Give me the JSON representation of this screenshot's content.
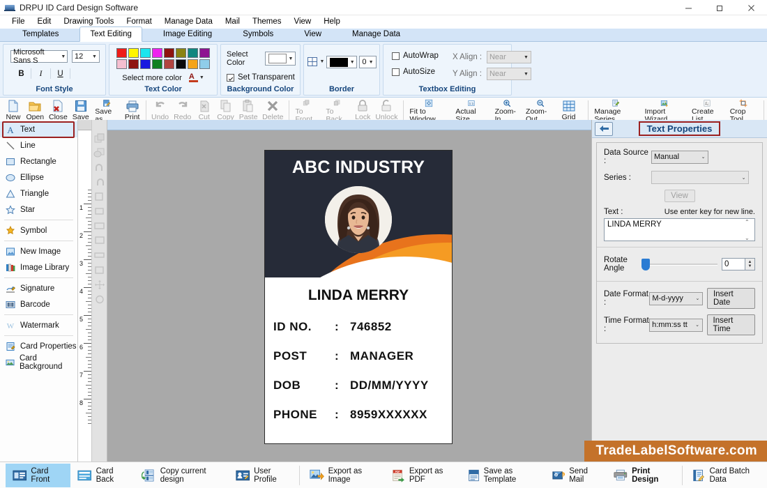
{
  "window": {
    "title": "DRPU ID Card Design Software",
    "minimize": "–",
    "maximize": "❐",
    "close": "✕"
  },
  "menubar": {
    "items": [
      "File",
      "Edit",
      "Drawing Tools",
      "Format",
      "Manage Data",
      "Mail",
      "Themes",
      "View",
      "Help"
    ]
  },
  "ribbon_tabs": {
    "items": [
      "Templates",
      "Text Editing",
      "Image Editing",
      "Symbols",
      "View",
      "Manage Data"
    ],
    "active": "Text Editing"
  },
  "ribbon": {
    "font_style": {
      "group_label": "Font Style",
      "font_name": "Microsoft Sans S",
      "font_size": "12",
      "bold": "B",
      "italic": "I",
      "underline": "U"
    },
    "text_color": {
      "group_label": "Text Color",
      "select_more_color": "Select more color",
      "font_color_glyph": "A",
      "swatches_row1": [
        "#ee1c18",
        "#fff600",
        "#1ce6ee",
        "#ee22ee",
        "#8e1410",
        "#8a8313",
        "#11877f",
        "#8e1491"
      ],
      "swatches_row2": [
        "#f5bfd0",
        "#8e1410",
        "#1919e0",
        "#0d8020",
        "#b14440",
        "#0a0a0a",
        "#f5a31a",
        "#8fcdea"
      ]
    },
    "background_color": {
      "group_label": "Background Color",
      "select_color_label": "Select Color",
      "selected_color": "#ffffff",
      "set_transparent": "Set Transparent",
      "set_transparent_checked": true
    },
    "border": {
      "group_label": "Border",
      "border_color": "#000000",
      "border_width": "0"
    },
    "textbox_editing": {
      "group_label": "Textbox Editing",
      "autowrap": "AutoWrap",
      "autowrap_checked": false,
      "autosize": "AutoSize",
      "autosize_checked": false,
      "x_align_label": "X Align :",
      "x_align_value": "Near",
      "y_align_label": "Y Align :",
      "y_align_value": "Near"
    }
  },
  "toolbar": {
    "groups": [
      [
        {
          "label": "New",
          "icon": "new-document-icon",
          "enabled": true
        },
        {
          "label": "Open",
          "icon": "open-folder-icon",
          "enabled": true
        },
        {
          "label": "Close",
          "icon": "close-document-icon",
          "enabled": true
        },
        {
          "label": "Save",
          "icon": "save-disk-icon",
          "enabled": true
        },
        {
          "label": "Save as",
          "icon": "save-as-icon",
          "enabled": true
        },
        {
          "label": "Print",
          "icon": "printer-icon",
          "enabled": true
        }
      ],
      [
        {
          "label": "Undo",
          "icon": "undo-arrow-icon",
          "enabled": false
        },
        {
          "label": "Redo",
          "icon": "redo-arrow-icon",
          "enabled": false
        },
        {
          "label": "Cut",
          "icon": "cut-icon",
          "enabled": false
        },
        {
          "label": "Copy",
          "icon": "copy-icon",
          "enabled": false
        },
        {
          "label": "Paste",
          "icon": "paste-icon",
          "enabled": false
        },
        {
          "label": "Delete",
          "icon": "delete-cross-icon",
          "enabled": false
        }
      ],
      [
        {
          "label": "To Front",
          "icon": "to-front-icon",
          "enabled": false
        },
        {
          "label": "To Back",
          "icon": "to-back-icon",
          "enabled": false
        },
        {
          "label": "Lock",
          "icon": "lock-icon",
          "enabled": false
        },
        {
          "label": "Unlock",
          "icon": "unlock-icon",
          "enabled": false
        }
      ],
      [
        {
          "label": "Fit to Window",
          "icon": "fit-to-window-icon",
          "enabled": true
        },
        {
          "label": "Actual Size",
          "icon": "actual-size-icon",
          "enabled": true
        },
        {
          "label": "Zoom-In",
          "icon": "zoom-in-icon",
          "enabled": true
        },
        {
          "label": "Zoom-Out",
          "icon": "zoom-out-icon",
          "enabled": true
        },
        {
          "label": "Grid",
          "icon": "grid-icon",
          "enabled": true
        }
      ],
      [
        {
          "label": "Manage Series",
          "icon": "manage-series-icon",
          "enabled": true
        },
        {
          "label": "Import Wizard",
          "icon": "import-wizard-icon",
          "enabled": true
        },
        {
          "label": "Create List",
          "icon": "create-list-icon",
          "enabled": true
        },
        {
          "label": "Crop Tool",
          "icon": "crop-tool-icon",
          "enabled": true
        }
      ]
    ]
  },
  "left_tools": {
    "selected": "Text",
    "groups": [
      [
        {
          "label": "Text",
          "icon": "text-a-icon"
        },
        {
          "label": "Line",
          "icon": "line-icon"
        },
        {
          "label": "Rectangle",
          "icon": "rectangle-icon"
        },
        {
          "label": "Ellipse",
          "icon": "ellipse-icon"
        },
        {
          "label": "Triangle",
          "icon": "triangle-icon"
        },
        {
          "label": "Star",
          "icon": "star-icon"
        }
      ],
      [
        {
          "label": "Symbol",
          "icon": "symbol-icon"
        }
      ],
      [
        {
          "label": "New Image",
          "icon": "new-image-icon"
        },
        {
          "label": "Image Library",
          "icon": "image-library-icon"
        }
      ],
      [
        {
          "label": "Signature",
          "icon": "signature-icon"
        },
        {
          "label": "Barcode",
          "icon": "barcode-icon"
        }
      ],
      [
        {
          "label": "Watermark",
          "icon": "watermark-icon"
        }
      ],
      [
        {
          "label": "Card Properties",
          "icon": "card-properties-icon"
        },
        {
          "label": "Card Background",
          "icon": "card-background-icon"
        }
      ]
    ]
  },
  "ruler": {
    "marks": [
      "1",
      "2",
      "3",
      "4",
      "5",
      "6",
      "7",
      "8"
    ]
  },
  "card": {
    "company_title": "ABC INDUSTRY",
    "holder_name": "LINDA MERRY",
    "header_bg": "#262b38",
    "accent_color": "#e8731c",
    "accent_color2": "#f59b23",
    "fields": [
      {
        "label": "ID NO.",
        "sep": ":",
        "value": "746852"
      },
      {
        "label": "POST",
        "sep": ":",
        "value": "MANAGER"
      },
      {
        "label": "DOB",
        "sep": ":",
        "value": "DD/MM/YYYY"
      },
      {
        "label": "PHONE",
        "sep": ":",
        "value": "8959XXXXXX"
      }
    ]
  },
  "right_panel": {
    "title": "Text Properties",
    "back_icon": "back-arrow-icon",
    "data_source_label": "Data Source :",
    "data_source_value": "Manual",
    "series_label": "Series :",
    "series_value": "",
    "view_button": "View",
    "text_label": "Text :",
    "text_hint": "Use enter key for new line.",
    "text_value": "LINDA MERRY",
    "rotate_label_line1": "Rotate",
    "rotate_label_line2": "Angle",
    "rotate_value": "0",
    "date_format_label": "Date Format :",
    "date_format_value": "M-d-yyyy",
    "insert_date_button": "Insert Date",
    "time_format_label": "Time Format :",
    "time_format_value": "h:mm:ss tt",
    "insert_time_button": "Insert Time"
  },
  "bottom_bar": {
    "items": [
      {
        "label": "Card Front",
        "icon": "card-front-icon",
        "selected": true,
        "bold": false
      },
      {
        "label": "Card Back",
        "icon": "card-back-icon",
        "selected": false,
        "bold": false
      },
      {
        "label": "Copy current design",
        "icon": "copy-design-icon",
        "selected": false,
        "bold": false
      },
      {
        "label": "User Profile",
        "icon": "user-profile-icon",
        "selected": false,
        "bold": false
      },
      {
        "label": "Export as Image",
        "icon": "export-image-icon",
        "selected": false,
        "bold": false
      },
      {
        "label": "Export as PDF",
        "icon": "export-pdf-icon",
        "selected": false,
        "bold": false
      },
      {
        "label": "Save as Template",
        "icon": "save-template-icon",
        "selected": false,
        "bold": false
      },
      {
        "label": "Send Mail",
        "icon": "send-mail-icon",
        "selected": false,
        "bold": false
      },
      {
        "label": "Print Design",
        "icon": "print-design-icon",
        "selected": false,
        "bold": true
      },
      {
        "label": "Card Batch Data",
        "icon": "card-batch-data-icon",
        "selected": false,
        "bold": false
      }
    ]
  },
  "watermark": {
    "text": "TradeLabelSoftware.com",
    "bg": "#c4722a"
  }
}
